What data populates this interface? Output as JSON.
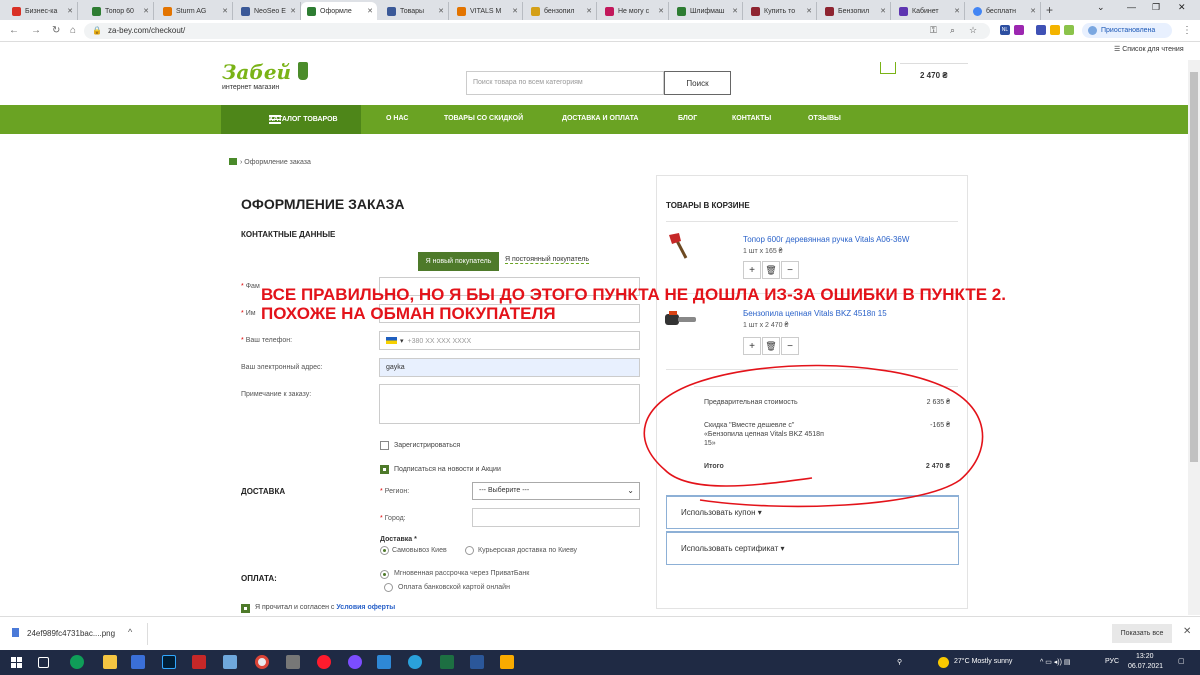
{
  "browser": {
    "tabs": [
      {
        "label": "Бизнес-ка",
        "color": "#d93025"
      },
      {
        "label": "Топор 60",
        "color": "#2e7d32"
      },
      {
        "label": "Sturm AG",
        "color": "#e37400"
      },
      {
        "label": "NeoSeo E",
        "color": "#3b5998"
      },
      {
        "label": "Оформле",
        "color": "#2e7d32",
        "active": true
      },
      {
        "label": "Товары",
        "color": "#3b5998"
      },
      {
        "label": "VITALS M",
        "color": "#e37400"
      },
      {
        "label": "бензопил",
        "color": "#d4a017"
      },
      {
        "label": "Не могу с",
        "color": "#c2185b"
      },
      {
        "label": "Шлифмаш",
        "color": "#2e7d32"
      },
      {
        "label": "Купить то",
        "color": "#8e2430"
      },
      {
        "label": "Бензопил",
        "color": "#8e2430"
      },
      {
        "label": "Кабинет",
        "color": "#5e35b1"
      },
      {
        "label": "бесплатн",
        "color": "#4285f4"
      }
    ],
    "url": "za-bey.com/checkout/",
    "profile_label": "Приостановлена",
    "reading_list": "Список для чтения",
    "ext_badge": "NL"
  },
  "site": {
    "logo_name": "Забей",
    "logo_sub": "интернет магазин",
    "search_placeholder": "Поиск товара по всем категориям",
    "search_button": "Поиск",
    "cart_total": "2 470 ₴",
    "menu": {
      "catalog": "КАТАЛОГ ТОВАРОВ",
      "items": [
        "О НАС",
        "ТОВАРЫ СО СКИДКОЙ",
        "ДОСТАВКА И ОПЛАТА",
        "БЛОГ",
        "КОНТАКТЫ",
        "ОТЗЫВЫ"
      ]
    }
  },
  "checkout": {
    "breadcrumb": "› Оформление заказа",
    "title": "ОФОРМЛЕНИЕ ЗАКАЗА",
    "contact_heading": "КОНТАКТНЫЕ ДАННЫЕ",
    "tab_new": "Я новый покупатель",
    "tab_existing": "Я постоянный покупатель",
    "fields": {
      "surname_label": "Фам",
      "name_label": "Им",
      "phone_label": "Ваш телефон:",
      "phone_placeholder": "+380 XX XXX XXXX",
      "email_label": "Ваш электронный адрес:",
      "email_value": "gayka",
      "comment_label": "Примечание к заказу:"
    },
    "register_label": "Зарегистрироваться",
    "subscribe_label": "Подписаться на новости и Акции",
    "delivery": {
      "heading": "ДОСТАВКА",
      "region_label": "Регион:",
      "region_value": "--- Выберите ---",
      "city_label": "Город:",
      "method_label": "Доставка",
      "option_pickup": "Самовывоз Киев",
      "option_courier": "Курьерская доставка по Киеву"
    },
    "payment": {
      "heading": "ОПЛАТА:",
      "option_installment": "Мгновенная рассрочка через ПриватБанк",
      "option_card": "Оплата банковской картой онлайн"
    },
    "agree_text": "Я прочитал и согласен с ",
    "agree_link": "Условия оферты"
  },
  "cart": {
    "heading": "ТОВАРЫ В КОРЗИНЕ",
    "items": [
      {
        "name": "Топор 600г деревянная ручка Vitals A06-36W",
        "qty": "1 шт x 165 ₴"
      },
      {
        "name": "Бензопила цепная Vitals BKZ 4518п 15",
        "qty": "1 шт x 2 470 ₴"
      }
    ],
    "subtotal_label": "Предварительная стоимость",
    "subtotal_value": "2 635 ₴",
    "discount_label_1": "Скидка \"Вместе дешевле с\"",
    "discount_label_2": "«Бензопила цепная Vitals BKZ 4518п",
    "discount_label_3": "15»",
    "discount_value": "-165 ₴",
    "total_label": "Итого",
    "total_value": "2 470 ₴",
    "coupon_label": "Использовать купон ▾",
    "certificate_label": "Использовать сертификат ▾"
  },
  "annotation": {
    "line1": "ВСЕ ПРАВИЛЬНО, НО Я БЫ ДО ЭТОГО ПУНКТА НЕ ДОШЛА ИЗ-ЗА ОШИБКИ В ПУНКТЕ 2.",
    "line2": "ПОХОЖЕ НА  ОБМАН ПОКУПАТЕЛЯ",
    "color": "#e3131a"
  },
  "downloads": {
    "file": "24ef989fc4731bac....png",
    "show_all": "Показать все"
  },
  "taskbar": {
    "weather": "27°C  Mostly sunny",
    "lang": "РУС",
    "time": "13:20",
    "date": "06.07.2021"
  }
}
